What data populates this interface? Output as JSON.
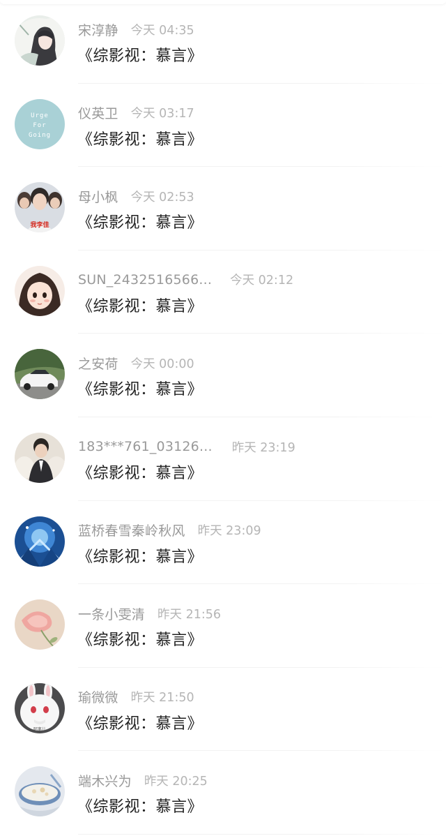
{
  "comments": [
    {
      "name": "宋淳静",
      "time": "今天 04:35",
      "title": "《综影视：慕言》",
      "avatar": "anime-girl-avatar"
    },
    {
      "name": "仪英卫",
      "time": "今天 03:17",
      "title": "《综影视：慕言》",
      "avatar": "urge-for-going-avatar",
      "avatar_text": [
        "Urge",
        "For",
        "Going"
      ]
    },
    {
      "name": "母小枫",
      "time": "今天 02:53",
      "title": "《综影视：慕言》",
      "avatar": "boy-group-avatar",
      "avatar_text": [
        "我李佳"
      ]
    },
    {
      "name": "SUN_2432516566...",
      "time": "今天 02:12",
      "title": "《综影视：慕言》",
      "avatar": "cartoon-girl-avatar"
    },
    {
      "name": "之安荷",
      "time": "今天 00:00",
      "title": "《综影视：慕言》",
      "avatar": "white-car-avatar"
    },
    {
      "name": "183***761_03126...",
      "time": "昨天 23:19",
      "title": "《综影视：慕言》",
      "avatar": "man-portrait-avatar"
    },
    {
      "name": "蓝桥春雪秦岭秋风",
      "time": "昨天 23:09",
      "title": "《综影视：慕言》",
      "avatar": "blue-fantasy-avatar"
    },
    {
      "name": "一条小雯清",
      "time": "昨天 21:56",
      "title": "《综影视：慕言》",
      "avatar": "flower-avatar"
    },
    {
      "name": "瑜微微",
      "time": "昨天 21:50",
      "title": "《综影视：慕言》",
      "avatar": "white-rabbit-avatar",
      "avatar_text": [
        "阿离儿"
      ]
    },
    {
      "name": "端木兴为",
      "time": "昨天 20:25",
      "title": "《综影视：慕言》",
      "avatar": "food-bowl-avatar"
    }
  ]
}
